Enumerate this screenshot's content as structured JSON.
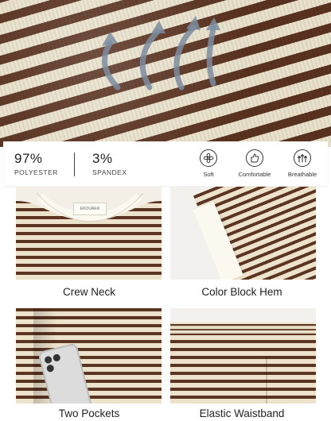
{
  "specs": [
    {
      "value": "97%",
      "label": "POLYESTER"
    },
    {
      "value": "3%",
      "label": "SPANDEX"
    }
  ],
  "features": [
    {
      "icon": "flower-icon",
      "label": "Soft"
    },
    {
      "icon": "hand-thumbs-up-icon",
      "label": "Comfortable"
    },
    {
      "icon": "wind-arrows-icon",
      "label": "Breathable"
    }
  ],
  "panels": [
    {
      "caption": "Crew Neck",
      "tag": "EKOUAER"
    },
    {
      "caption": "Color Block Hem"
    },
    {
      "caption": "Two Pockets"
    },
    {
      "caption": "Elastic Waistband"
    }
  ],
  "colors": {
    "stripe": "#5b3422",
    "base": "#ede3cd",
    "trim": "#fbf8f0"
  }
}
